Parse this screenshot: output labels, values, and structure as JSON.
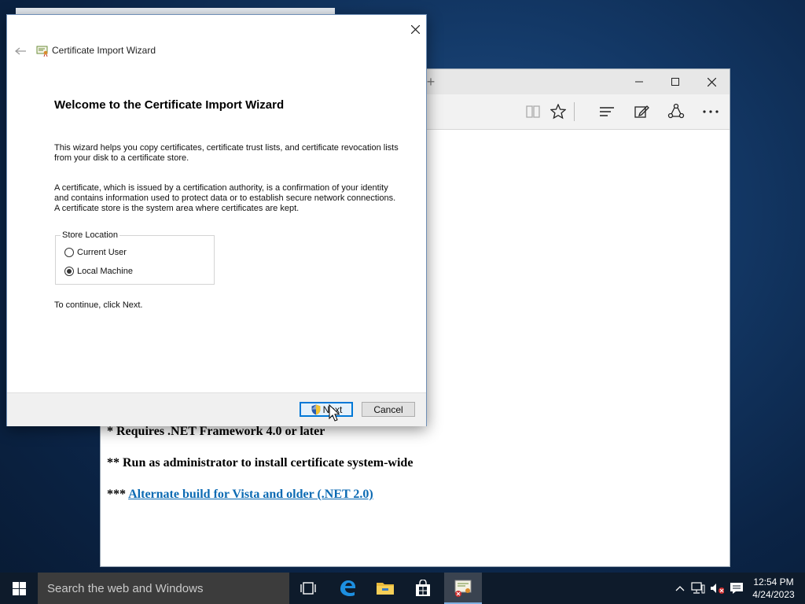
{
  "wizard": {
    "title": "Certificate Import Wizard",
    "heading": "Welcome to the Certificate Import Wizard",
    "para1": "This wizard helps you copy certificates, certificate trust lists, and certificate revocation lists from your disk to a certificate store.",
    "para2": "A certificate, which is issued by a certification authority, is a confirmation of your identity and contains information used to protect data or to establish secure network connections. A certificate store is the system area where certificates are kept.",
    "store_location_label": "Store Location",
    "options": [
      {
        "label": "Current User",
        "selected": false
      },
      {
        "label": "Local Machine",
        "selected": true
      }
    ],
    "continue_text": "To continue, click Next.",
    "next_label": "Next",
    "cancel_label": "Cancel"
  },
  "browser": {
    "line1": "* Requires .NET Framework 4.0 or later",
    "line2": "** Run as administrator to install certificate system-wide",
    "line3_prefix": "***",
    "line3_link": "Alternate build for Vista and older (.NET 2.0)"
  },
  "taskbar": {
    "search_placeholder": "Search the web and Windows",
    "time": "12:54 PM",
    "date": "4/24/2023"
  },
  "icons": {
    "wizard": [
      "back-arrow-icon",
      "certificate-icon",
      "close-icon",
      "uac-shield-icon"
    ],
    "browser": [
      "reading-view-icon",
      "favorite-star-icon",
      "hub-icon",
      "web-note-icon",
      "share-icon",
      "more-icon"
    ],
    "taskbar": [
      "windows-start-icon",
      "task-view-icon",
      "edge-icon",
      "file-explorer-icon",
      "store-icon",
      "certificate-app-icon",
      "chevron-up-icon",
      "network-icon",
      "volume-muted-icon",
      "action-center-icon"
    ]
  },
  "colors": {
    "accent": "#0078d7",
    "link": "#0b6ab3",
    "taskbar": "#0e1b2b"
  }
}
